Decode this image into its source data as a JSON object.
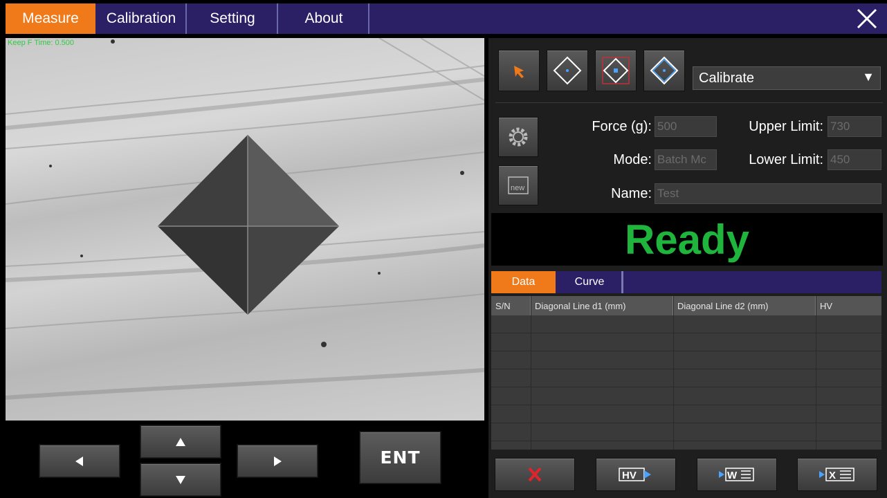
{
  "tabs": [
    {
      "label": "Measure",
      "active": true
    },
    {
      "label": "Calibration",
      "active": false
    },
    {
      "label": "Setting",
      "active": false
    },
    {
      "label": "About",
      "active": false
    }
  ],
  "camera": {
    "overlay_text": "Keep F Time: 0.500"
  },
  "pad": {
    "ent_label": "ENT"
  },
  "toolbar": {
    "tools": [
      "select-arrow-icon",
      "diamond-measure-icon",
      "diamond-box-icon",
      "diamond-blue-icon"
    ],
    "mode_select": "Calibrate"
  },
  "params": {
    "force_label": "Force (g):",
    "force_value": "500",
    "upper_label": "Upper Limit:",
    "upper_value": "730",
    "mode_label": "Mode:",
    "mode_value": "Batch Mc",
    "lower_label": "Lower Limit:",
    "lower_value": "450",
    "name_label": "Name:",
    "name_value": "Test"
  },
  "status": {
    "text": "Ready",
    "color": "#1fb53c"
  },
  "subtabs": [
    {
      "label": "Data",
      "active": true
    },
    {
      "label": "Curve",
      "active": false
    }
  ],
  "table": {
    "columns": [
      "S/N",
      "Diagonal Line d1 (mm)",
      "Diagonal Line d2 (mm)",
      "HV"
    ],
    "rows": []
  },
  "actions": [
    "delete-icon",
    "hv-icon",
    "export-word-icon",
    "export-excel-icon"
  ],
  "colors": {
    "accent": "#f07a1a",
    "navy": "#2b1f66",
    "status_green": "#1fb53c"
  }
}
